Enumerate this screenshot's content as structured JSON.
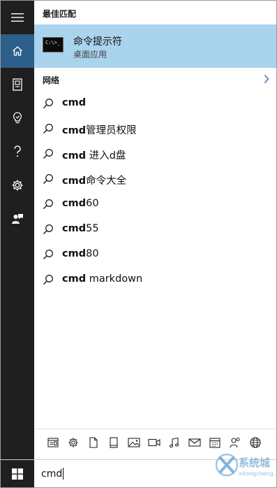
{
  "sections": {
    "best_match": "最佳匹配",
    "web": "网络"
  },
  "best_match_item": {
    "title": "命令提示符",
    "subtitle": "桌面应用",
    "icon": "cmd-console-icon",
    "icon_text": "C:\\>_"
  },
  "suggestions": [
    {
      "bold": "cmd",
      "rest": ""
    },
    {
      "bold": "cmd",
      "rest": "管理员权限"
    },
    {
      "bold": "cmd",
      "rest": " 进入d盘"
    },
    {
      "bold": "cmd",
      "rest": "命令大全"
    },
    {
      "bold": "cmd",
      "rest": "60"
    },
    {
      "bold": "cmd",
      "rest": "55"
    },
    {
      "bold": "cmd",
      "rest": "80"
    },
    {
      "bold": "cmd",
      "rest": " markdown"
    }
  ],
  "rail_icons": [
    "hamburger-menu-icon",
    "home-icon",
    "notebook-icon",
    "lightbulb-icon",
    "help-icon",
    "settings-icon",
    "feedback-icon"
  ],
  "filter_icons": [
    "apps-icon",
    "settings-icon",
    "documents-icon",
    "folders-icon",
    "photos-icon",
    "videos-icon",
    "music-icon",
    "email-icon",
    "calendar-icon",
    "people-icon",
    "web-icon"
  ],
  "search": {
    "value": "cmd"
  },
  "watermark": {
    "title": "系统城",
    "url": "xitongcheng.cc"
  },
  "colors": {
    "rail": "#1f1f1f",
    "rail_active": "#2c5f8a",
    "highlight": "#aad3ee",
    "watermark": "#6fa8d6"
  }
}
